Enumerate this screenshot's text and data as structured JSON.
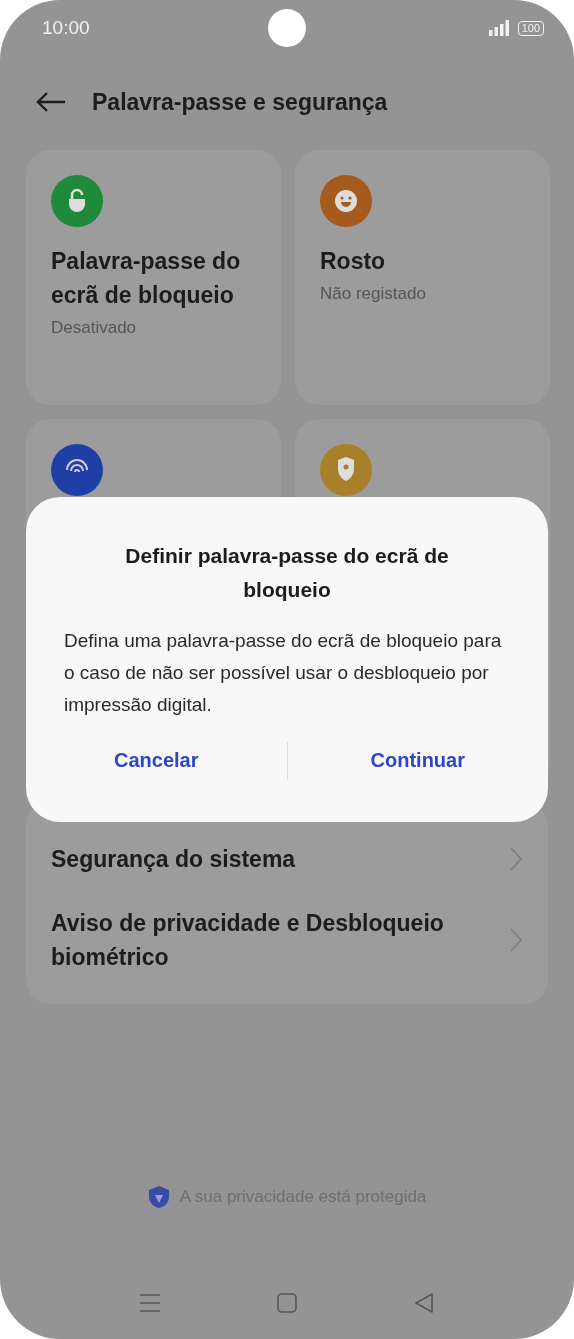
{
  "status_bar": {
    "time": "10:00",
    "battery": "100"
  },
  "header": {
    "title": "Palavra-passe e segurança"
  },
  "tiles": [
    {
      "kind": "lock",
      "color": "#1e8a3a",
      "title": "Palavra-passe do ecrã de bloqueio",
      "subtitle": "Desativado"
    },
    {
      "kind": "face",
      "color": "#a65a1c",
      "title": "Rosto",
      "subtitle": "Não registado"
    },
    {
      "kind": "fingerprint",
      "color": "#1f3fa6"
    },
    {
      "kind": "shield",
      "color": "#a8802a"
    }
  ],
  "list": [
    {
      "label": "Segurança do sistema"
    },
    {
      "label": "Aviso de privacidade e Desbloqueio biométrico"
    }
  ],
  "footer": {
    "text": "A sua privacidade está protegida"
  },
  "dialog": {
    "title": "Definir palavra-passe do ecrã de bloqueio",
    "message": "Defina uma palavra-passe do ecrã de bloqueio para o caso de não ser possível usar o desbloqueio por impressão digital.",
    "buttons": [
      "Cancelar",
      "Continuar"
    ]
  }
}
